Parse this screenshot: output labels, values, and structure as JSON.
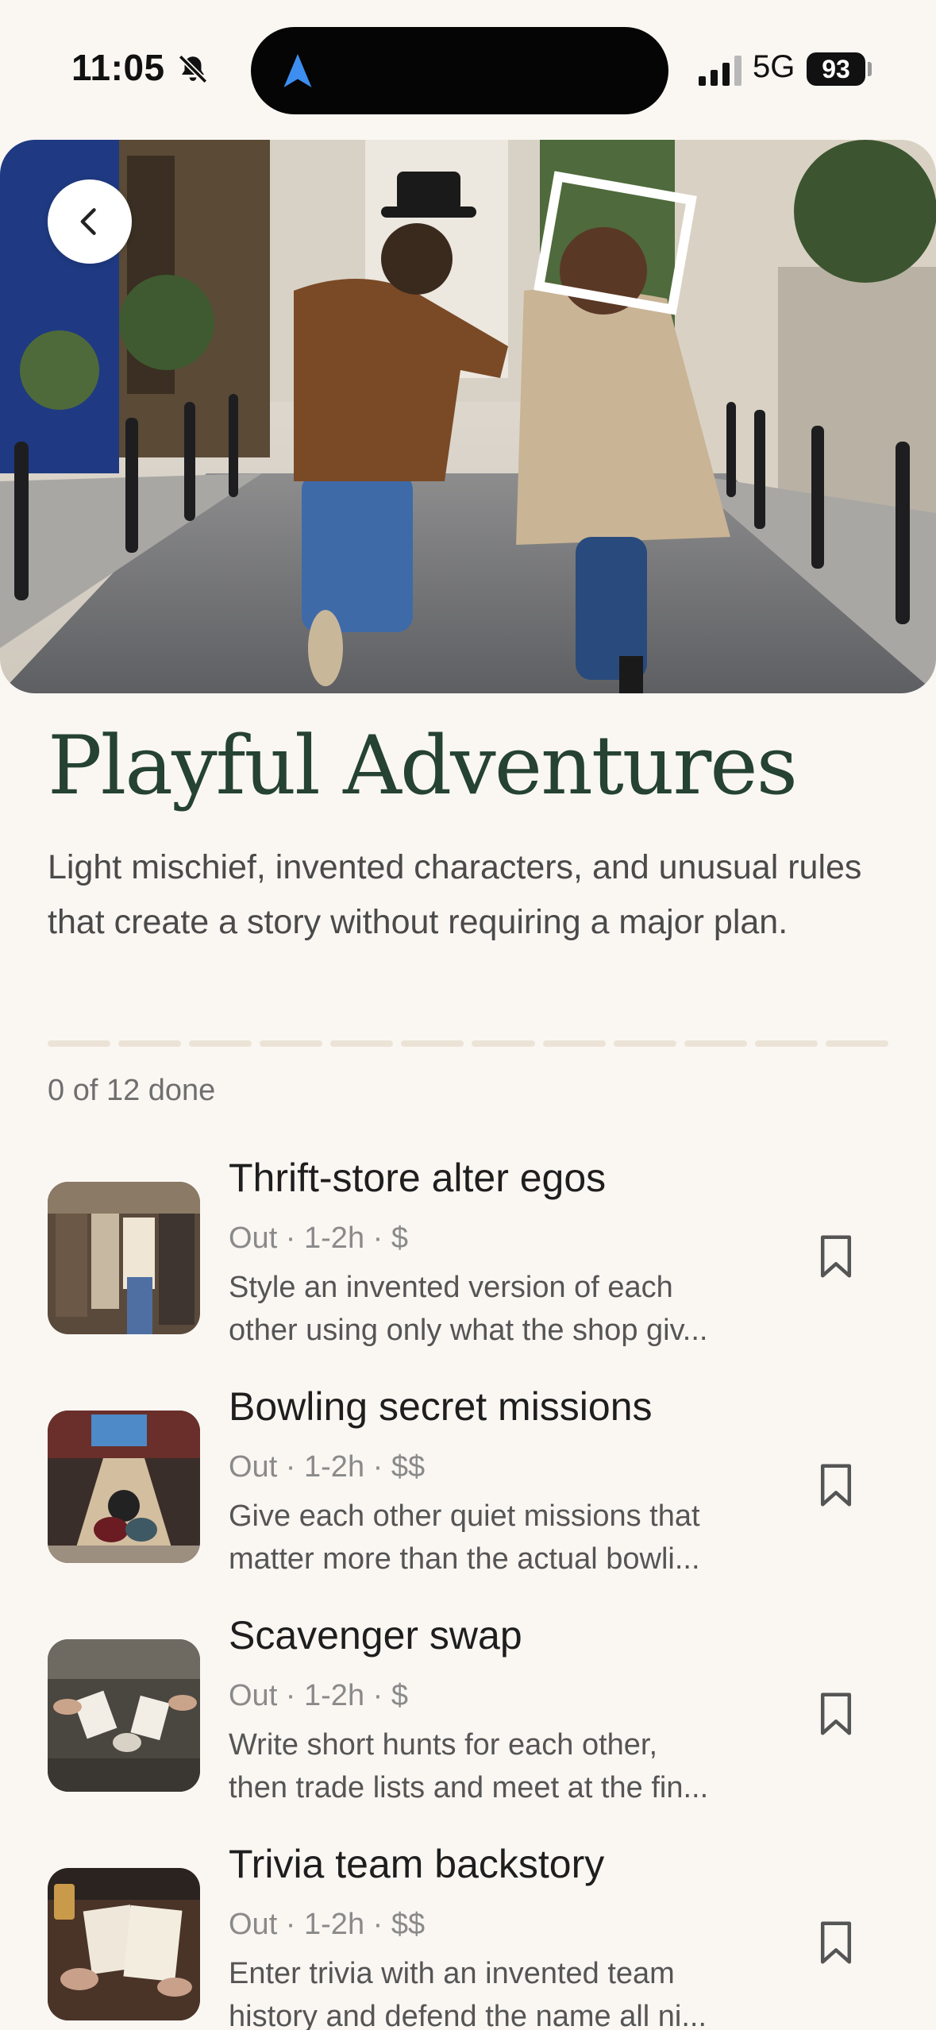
{
  "status_bar": {
    "time": "11:05",
    "network": "5G",
    "battery": "93"
  },
  "icons": {
    "bell_off": "bell-slash-icon",
    "navigation": "location-arrow-icon",
    "signal": "cellular-signal-icon",
    "back": "chevron-left-icon",
    "bookmark": "bookmark-icon"
  },
  "page": {
    "title": "Playful Adventures",
    "description": "Light mischief, invented characters, and unusual rules that create a story without requiring a major plan.",
    "progress_text": "0 of 12 done",
    "progress_total": 12,
    "progress_done": 0
  },
  "colors": {
    "title": "#254232",
    "background": "#faf7f3",
    "progress_segment": "#ece3d7"
  },
  "items": [
    {
      "title": "Thrift-store alter egos",
      "meta": "Out · 1-2h · $",
      "desc_line1": "Style an invented version of each",
      "desc_line2": "other using only what the shop giv..."
    },
    {
      "title": "Bowling secret missions",
      "meta": "Out · 1-2h · $$",
      "desc_line1": "Give each other quiet missions that",
      "desc_line2": "matter more than the actual bowli..."
    },
    {
      "title": "Scavenger swap",
      "meta": "Out · 1-2h · $",
      "desc_line1": "Write short hunts for each other,",
      "desc_line2": "then trade lists and meet at the fin..."
    },
    {
      "title": "Trivia team backstory",
      "meta": "Out · 1-2h · $$",
      "desc_line1": "Enter trivia with an invented team",
      "desc_line2": "history and defend the name all ni..."
    }
  ]
}
